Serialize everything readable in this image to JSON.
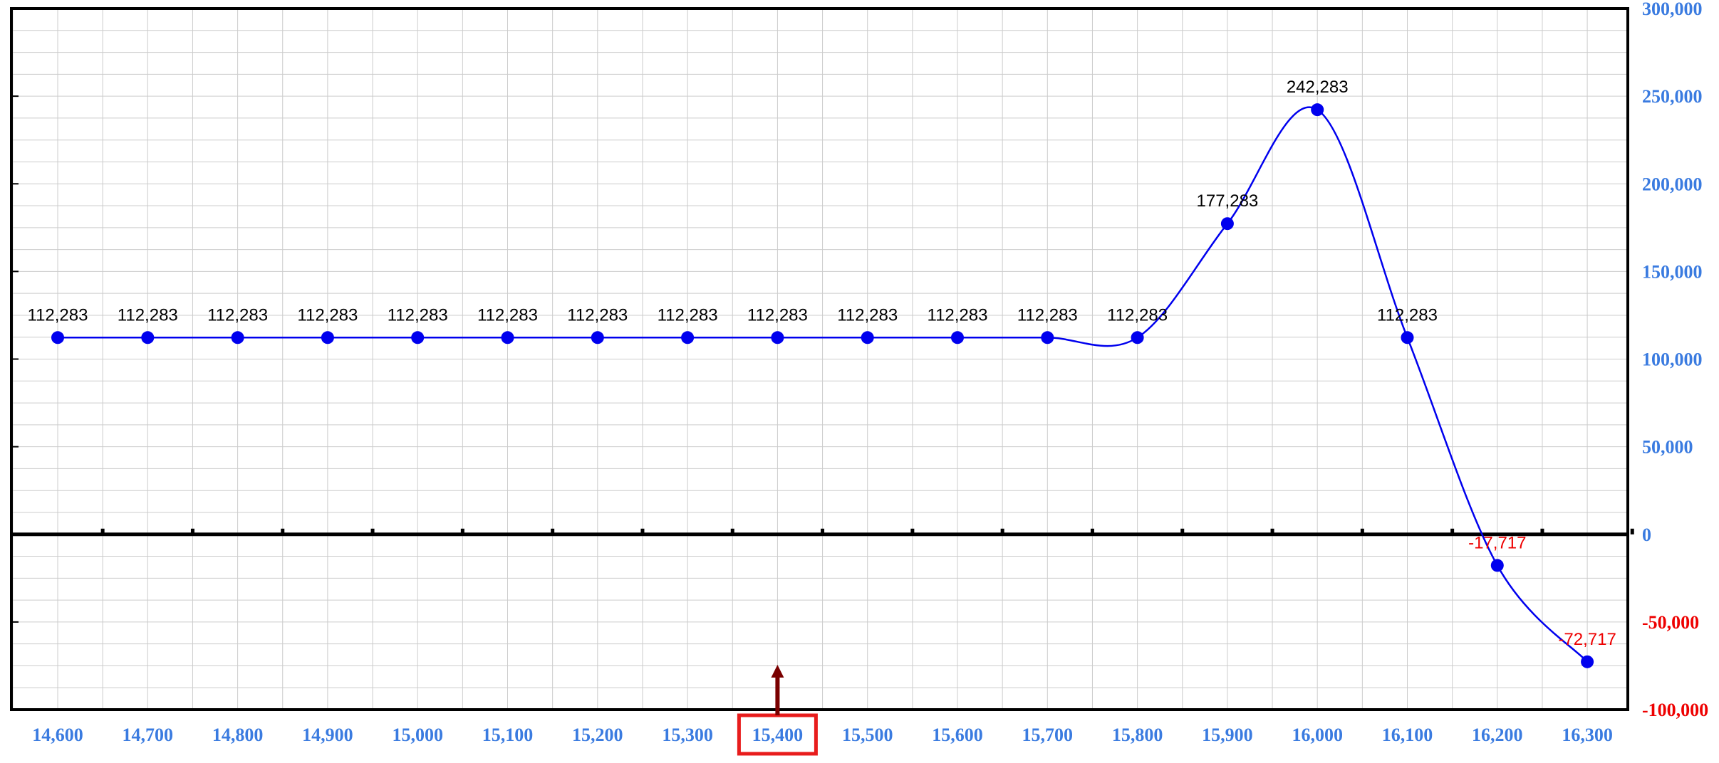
{
  "chart_data": {
    "type": "line",
    "title": "",
    "xlabel": "",
    "ylabel": "",
    "x": [
      14600,
      14700,
      14800,
      14900,
      15000,
      15100,
      15200,
      15300,
      15400,
      15500,
      15600,
      15700,
      15800,
      15900,
      16000,
      16100,
      16200,
      16300
    ],
    "x_tick_labels": [
      "14,600",
      "14,700",
      "14,800",
      "14,900",
      "15,000",
      "15,100",
      "15,200",
      "15,300",
      "15,400",
      "15,500",
      "15,600",
      "15,700",
      "15,800",
      "15,900",
      "16,000",
      "16,100",
      "16,200",
      "16,300"
    ],
    "series": [
      {
        "values": [
          112283,
          112283,
          112283,
          112283,
          112283,
          112283,
          112283,
          112283,
          112283,
          112283,
          112283,
          112283,
          112283,
          177283,
          242283,
          112283,
          -17717,
          -72717
        ],
        "data_labels": [
          "112,283",
          "112,283",
          "112,283",
          "112,283",
          "112,283",
          "112,283",
          "112,283",
          "112,283",
          "112,283",
          "112,283",
          "112,283",
          "112,283",
          "112,283",
          "177,283",
          "242,283",
          "112,283",
          "-17,717",
          "-72,717"
        ]
      }
    ],
    "ylim": [
      -100000,
      300000
    ],
    "y_ticks": [
      300000,
      250000,
      200000,
      150000,
      100000,
      50000,
      0,
      -50000,
      -100000
    ],
    "y_tick_labels": [
      "300,000",
      "250,000",
      "200,000",
      "150,000",
      "100,000",
      "50,000",
      "0",
      "-50,000",
      "-100,000"
    ],
    "y_axis_position": "right",
    "grid": true,
    "highlighted_x": 15400,
    "highlighted_x_label": "15,400",
    "colors": {
      "line": "#0000ee",
      "marker": "#0000ee",
      "tick_label": "#3a7be0",
      "negative": "#ee0000",
      "highlight_box": "#e81c1c",
      "arrow": "#7a0000",
      "grid": "#cccccc",
      "axis": "#000000",
      "data_label": "#000000"
    }
  }
}
